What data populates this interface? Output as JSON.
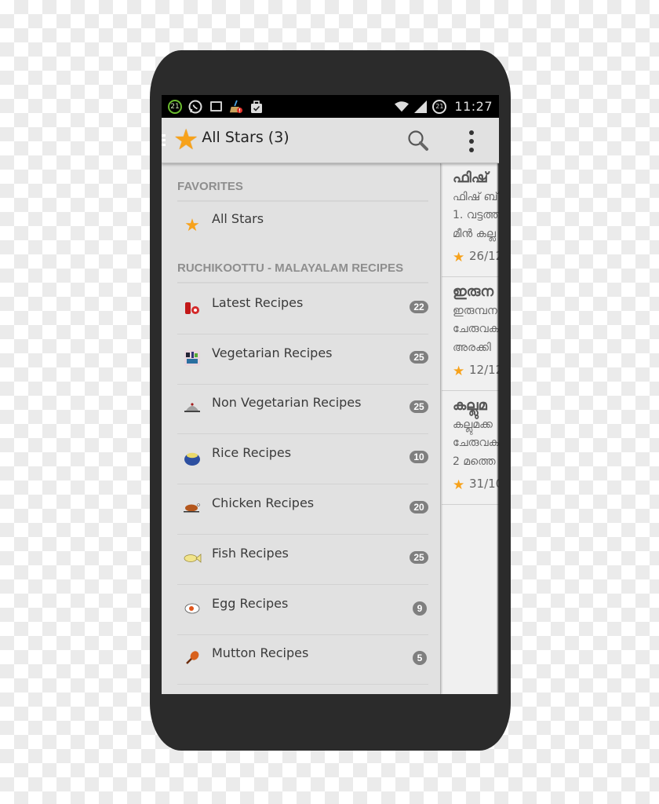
{
  "status_bar": {
    "notification_count": "21",
    "battery_level": "21",
    "time": "11:27",
    "left_icons": [
      "progress-ring-icon",
      "whatsapp-icon",
      "image-icon",
      "cleaner-icon",
      "briefcase-icon"
    ],
    "right_icons": [
      "wifi-icon",
      "signal-icon",
      "battery-icon"
    ]
  },
  "action_bar": {
    "title": "All Stars (3)",
    "icons": [
      "drawer-indicator-icon",
      "star-icon",
      "search-icon",
      "overflow-menu-icon"
    ]
  },
  "drawer": {
    "favorites_header": "FAVORITES",
    "favorites": [
      {
        "label": "All Stars",
        "icon": "star-icon"
      }
    ],
    "recipes_header": "RUCHIKOOTTU - MALAYALAM RECIPES",
    "categories": [
      {
        "label": "Latest Recipes",
        "count": "22",
        "icon": "latest-recipes-icon"
      },
      {
        "label": "Vegetarian Recipes",
        "count": "25",
        "icon": "vegetarian-icon"
      },
      {
        "label": "Non Vegetarian Recipes",
        "count": "25",
        "icon": "cloche-icon"
      },
      {
        "label": "Rice Recipes",
        "count": "10",
        "icon": "rice-pot-icon"
      },
      {
        "label": "Chicken Recipes",
        "count": "20",
        "icon": "roast-chicken-icon"
      },
      {
        "label": "Fish Recipes",
        "count": "25",
        "icon": "fish-icon"
      },
      {
        "label": "Egg Recipes",
        "count": "9",
        "icon": "egg-icon"
      },
      {
        "label": "Mutton Recipes",
        "count": "5",
        "icon": "drumstick-icon"
      }
    ]
  },
  "content": {
    "cards": [
      {
        "title": "ഫിഷ്",
        "lines": [
          "ഫിഷ് ബ്",
          "1. വട്ടത്ത്",
          "മീൻ കല്ല"
        ],
        "date": "26/12"
      },
      {
        "title": "ഇരുന",
        "lines": [
          "ഇരുമ്പന",
          "ചേരുവക",
          "അരക്കി"
        ],
        "date": "12/12"
      },
      {
        "title": "കല്ലുമ",
        "lines": [
          "കല്ലുമക്ക",
          "ചേരുവക",
          "2 മത്തെ"
        ],
        "date": "31/10"
      }
    ]
  }
}
